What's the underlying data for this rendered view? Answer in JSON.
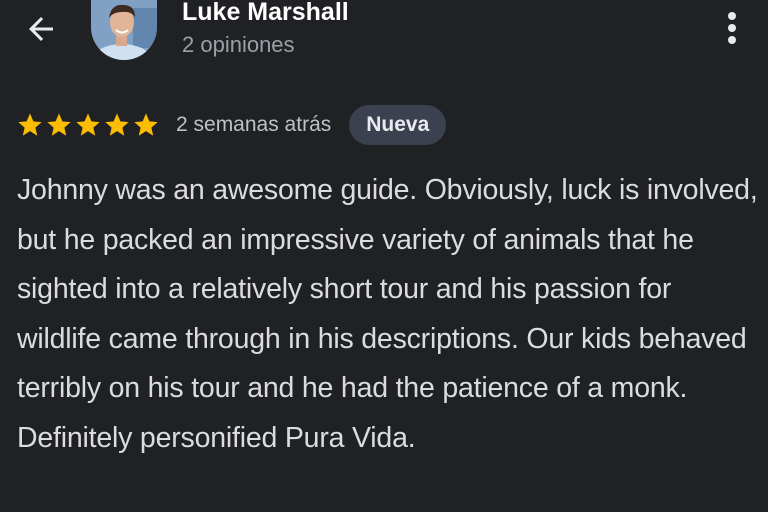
{
  "header": {
    "back_icon": "arrow-left-icon",
    "avatar_icon": "user-avatar",
    "user_name": "Luke Marshall",
    "review_count": "2 opiniones",
    "more_icon": "more-vertical-icon"
  },
  "review": {
    "rating": 5,
    "rating_max": 5,
    "star_icon": "star-icon",
    "date": "2 semanas atrás",
    "badge": "Nueva",
    "text": "Johnny was an awesome guide. Obviously, luck is involved, but he packed an impressive variety of animals that he sighted into a relatively short tour and his passion for wildlife came through in his descriptions. Our kids behaved terribly on his tour and he had the patience of a monk. Definitely personified Pura Vida."
  },
  "colors": {
    "background": "#202124",
    "star": "#fbbc04",
    "badge_bg": "#3c4150",
    "secondary_text": "#9aa0a6"
  }
}
